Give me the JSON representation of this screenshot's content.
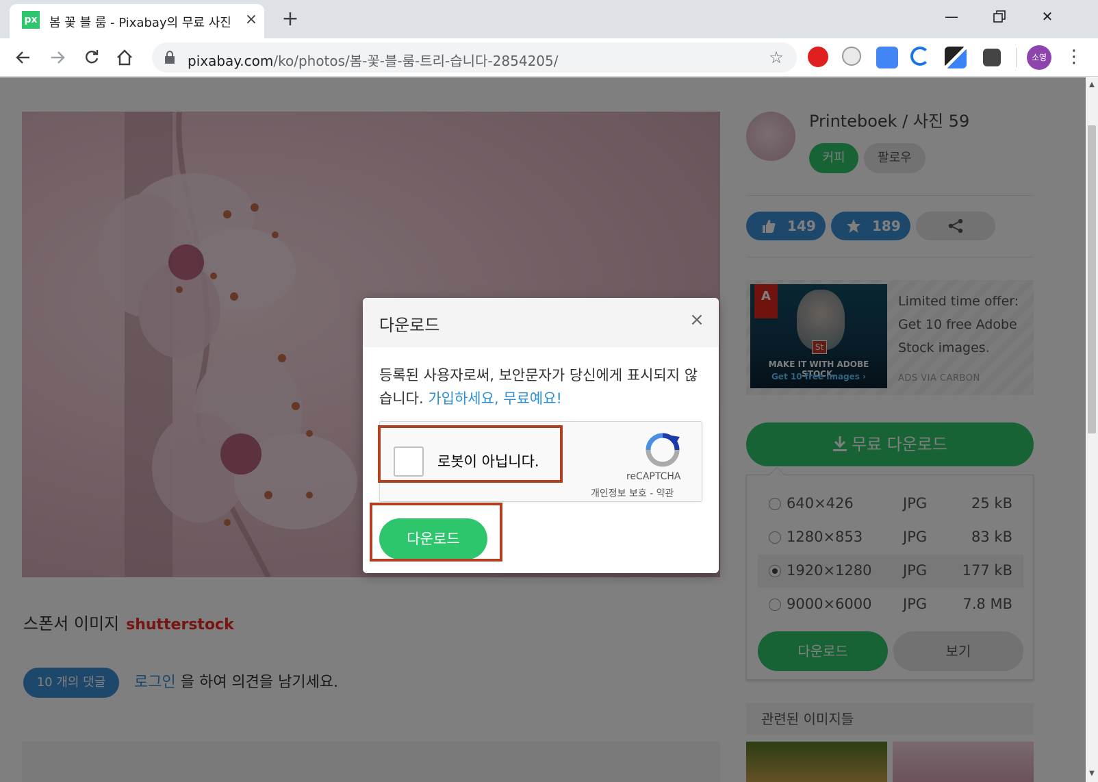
{
  "browser": {
    "tab_title": "봄 꽃 블 룸 - Pixabay의 무료 사진",
    "favicon_text": "px",
    "url_host": "pixabay.com",
    "url_path": "/ko/photos/봄-꽃-블-룸-트리-습니다-2854205/",
    "avatar_label": "소영"
  },
  "author": {
    "name": "Printeboek / 사진 59",
    "coffee_label": "커피",
    "follow_label": "팔로우"
  },
  "stats": {
    "likes": "149",
    "favorites": "189"
  },
  "ad": {
    "text": "Limited time offer: Get 10 free Adobe Stock images.",
    "via": "ADS VIA CARBON",
    "logo_text": "A",
    "st_text": "St",
    "img_line1": "MAKE IT WITH ADOBE STOCK.",
    "img_line2": "Get 10 free images ›"
  },
  "download_panel": {
    "free_download_label": "무료 다운로드",
    "options": [
      {
        "dim": "640×426",
        "format": "JPG",
        "size": "25 kB",
        "selected": false
      },
      {
        "dim": "1280×853",
        "format": "JPG",
        "size": "83 kB",
        "selected": false
      },
      {
        "dim": "1920×1280",
        "format": "JPG",
        "size": "177 kB",
        "selected": true
      },
      {
        "dim": "9000×6000",
        "format": "JPG",
        "size": "7.8 MB",
        "selected": false
      }
    ],
    "download_label": "다운로드",
    "view_label": "보기"
  },
  "related_title": "관련된 이미지들",
  "sponsor": {
    "label": "스폰서 이미지",
    "brand": "shutterstock"
  },
  "comments": {
    "count_label": "10 개의 댓글",
    "login_link": "로그인",
    "login_rest": " 을 하여 의견을 남기세요."
  },
  "modal": {
    "title": "다운로드",
    "close": "×",
    "message": "등록된 사용자로써, 보안문자가 당신에게 표시되지 않습니다. ",
    "message_link": "가입하세요, 무료예요!",
    "captcha_label": "로봇이 아닙니다.",
    "captcha_brand": "reCAPTCHA",
    "captcha_terms": "개인정보 보호 - 약관",
    "download_label": "다운로드"
  }
}
